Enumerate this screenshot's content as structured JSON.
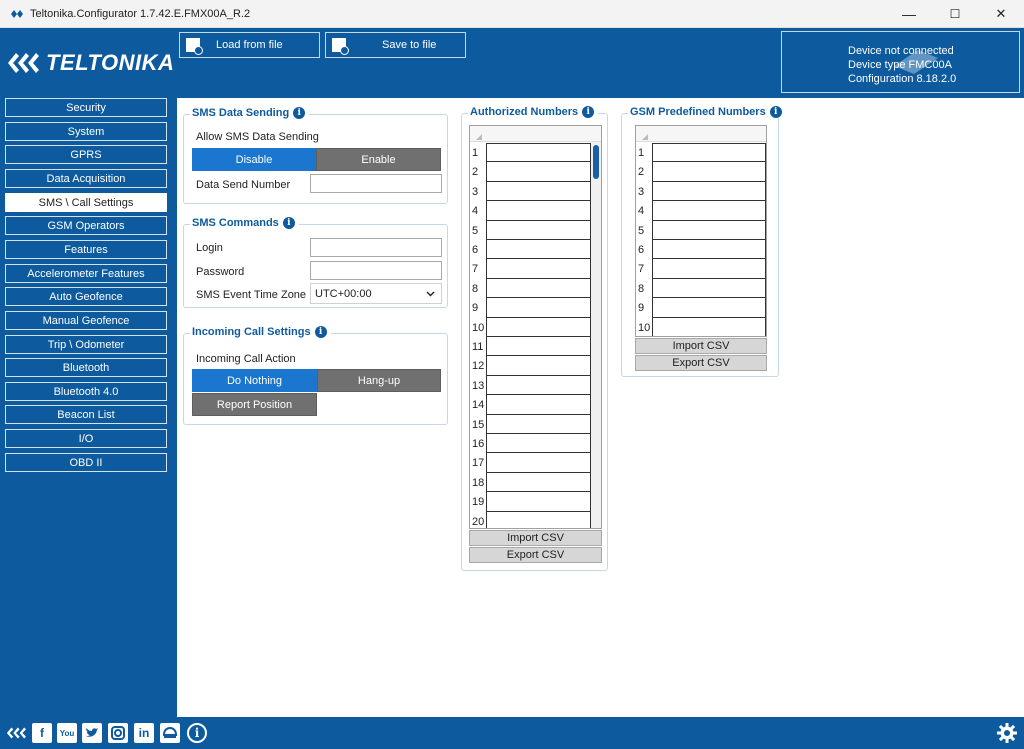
{
  "window": {
    "title": "Teltonika.Configurator 1.7.42.E.FMX00A_R.2",
    "minimize": "—",
    "maximize": "☐",
    "close": "✕"
  },
  "header": {
    "logo_text": "TELTONIKA",
    "load_button": "Load from file",
    "save_button": "Save to file",
    "device_status": "Device not connected",
    "device_type": "Device type  FMC00A",
    "configuration": "Configuration  8.18.2.0"
  },
  "sidebar": {
    "items": [
      {
        "label": "Security"
      },
      {
        "label": "System"
      },
      {
        "label": "GPRS"
      },
      {
        "label": "Data Acquisition"
      },
      {
        "label": "SMS \\ Call Settings"
      },
      {
        "label": "GSM Operators"
      },
      {
        "label": "Features"
      },
      {
        "label": "Accelerometer Features"
      },
      {
        "label": "Auto Geofence"
      },
      {
        "label": "Manual Geofence"
      },
      {
        "label": "Trip \\ Odometer"
      },
      {
        "label": "Bluetooth"
      },
      {
        "label": "Bluetooth 4.0"
      },
      {
        "label": "Beacon List"
      },
      {
        "label": "I/O"
      },
      {
        "label": "OBD II"
      }
    ],
    "active": "SMS \\ Call Settings"
  },
  "sms_data_sending": {
    "title": "SMS Data Sending",
    "allow_label": "Allow SMS Data Sending",
    "disable": "Disable",
    "enable": "Enable",
    "selected": "Disable",
    "send_number_label": "Data Send Number",
    "send_number_value": ""
  },
  "sms_commands": {
    "title": "SMS Commands",
    "login_label": "Login",
    "login_value": "",
    "password_label": "Password",
    "password_value": "",
    "timezone_label": "SMS Event Time Zone",
    "timezone_value": "UTC+00:00"
  },
  "incoming_call": {
    "title": "Incoming Call Settings",
    "action_label": "Incoming Call Action",
    "do_nothing": "Do Nothing",
    "hang_up": "Hang-up",
    "report_position": "Report Position",
    "selected": "Do Nothing"
  },
  "authorized_numbers": {
    "title": "Authorized Numbers",
    "rows": [
      "1",
      "2",
      "3",
      "4",
      "5",
      "6",
      "7",
      "8",
      "9",
      "10",
      "11",
      "12",
      "13",
      "14",
      "15",
      "16",
      "17",
      "18",
      "19",
      "20"
    ],
    "import_csv": "Import CSV",
    "export_csv": "Export CSV"
  },
  "gsm_predefined": {
    "title": "GSM Predefined Numbers",
    "rows": [
      "1",
      "2",
      "3",
      "4",
      "5",
      "6",
      "7",
      "8",
      "9",
      "10"
    ],
    "import_csv": "Import CSV",
    "export_csv": "Export CSV"
  },
  "footer": {
    "icons": [
      "teltonika-icon",
      "facebook-icon",
      "youtube-icon",
      "twitter-icon",
      "instagram-icon",
      "linkedin-icon",
      "car-icon",
      "info-icon"
    ],
    "facebook": "f",
    "youtube": "You",
    "linkedin": "in",
    "info": "i"
  },
  "colors": {
    "brand_blue": "#0d5a9e",
    "active_blue": "#1a76cf",
    "inactive_gray": "#707070"
  }
}
